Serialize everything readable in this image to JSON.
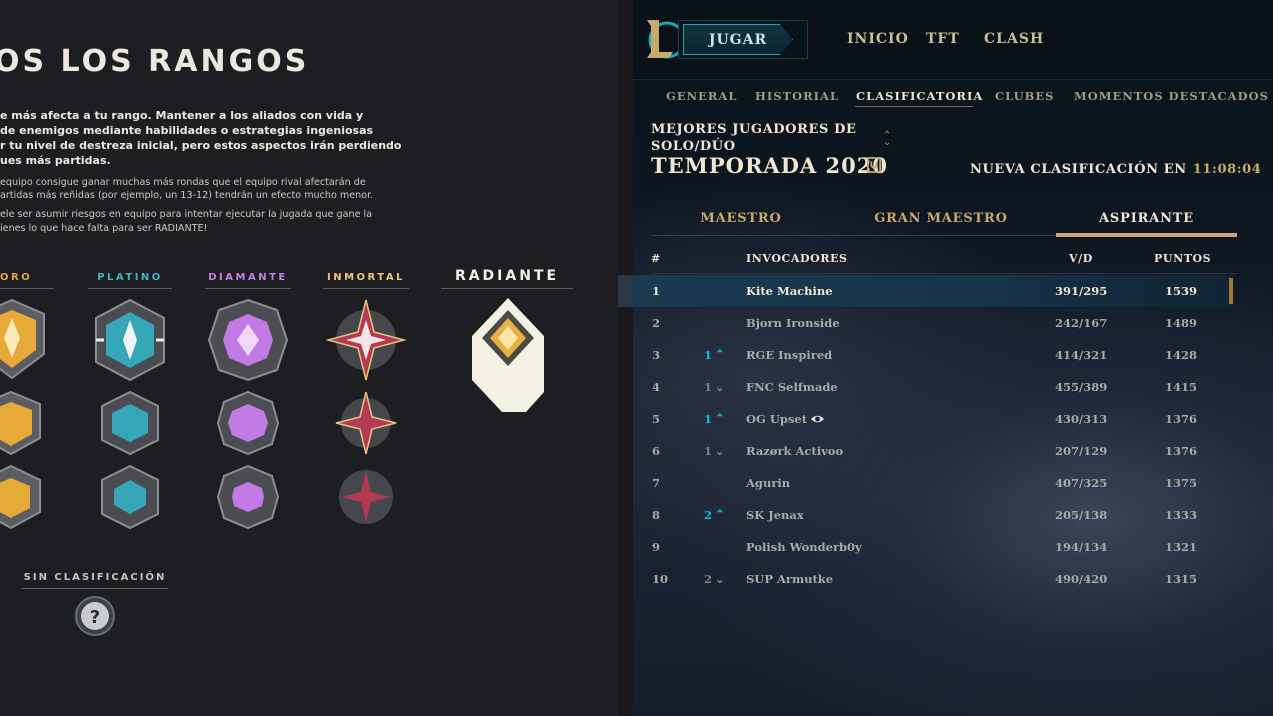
{
  "left": {
    "title": "OS LOS RANGOS",
    "paragraphs_bold": [
      "e más afecta a tu rango. Mantener a los aliados con vida y",
      "de enemigos mediante habilidades o estrategias ingeniosas",
      "r tu nivel de destreza inicial, pero estos aspectos irán perdiendo",
      "ues más partidas."
    ],
    "paragraphs_small": [
      "equipo consigue ganar muchas más rondas que el equipo rival afectarán de",
      "artidas más reñidas (por ejemplo, un 13-12) tendrán un efecto mucho menor.",
      "ele ser asumir riesgos en equipo para intentar ejecutar la jugada que gane la",
      "ienes lo que hace falta para ser RADIANTE!"
    ],
    "tiers": [
      {
        "label": "ORO",
        "color": "#e0a73a"
      },
      {
        "label": "PLATINO",
        "color": "#3fb6c6"
      },
      {
        "label": "DIAMANTE",
        "color": "#c77fe6"
      },
      {
        "label": "INMORTAL",
        "color": "#e9c77a"
      },
      {
        "label": "RADIANTE",
        "color": "#f3f0e6"
      }
    ],
    "unranked_label": "SIN CLASIFICACIÓN",
    "unranked_icon": "?"
  },
  "topbar": {
    "play_label": "JUGAR",
    "nav": [
      "INICIO",
      "TFT",
      "CLASH"
    ]
  },
  "subnav": [
    "GENERAL",
    "HISTORIAL",
    "CLASIFICATORIA",
    "CLUBES",
    "MOMENTOS DESTACADOS"
  ],
  "subnav_active": "CLASIFICATORIA",
  "ranked": {
    "queue_line1": "MEJORES JUGADORES DE",
    "queue_line2": "SOLO/DÚO",
    "season": "TEMPORADA 2020",
    "new_rank_label": "NUEVA CLASIFICACIÓN EN",
    "new_rank_time": "11:08:04",
    "tabs": [
      "MAESTRO",
      "GRAN MAESTRO",
      "ASPIRANTE"
    ],
    "active_tab": "ASPIRANTE",
    "columns": [
      "#",
      "INVOCADORES",
      "V/D",
      "PUNTOS"
    ],
    "rows": [
      {
        "rank": "1",
        "change": "",
        "dir": "",
        "name": "Kite Machine",
        "wl": "391/295",
        "pts": "1539"
      },
      {
        "rank": "2",
        "change": "",
        "dir": "",
        "name": "Bjorn Ironside",
        "wl": "242/167",
        "pts": "1489"
      },
      {
        "rank": "3",
        "change": "1",
        "dir": "up",
        "name": "RGE Inspired",
        "wl": "414/321",
        "pts": "1428"
      },
      {
        "rank": "4",
        "change": "1",
        "dir": "down",
        "name": "FNC Selfmade",
        "wl": "455/389",
        "pts": "1415"
      },
      {
        "rank": "5",
        "change": "1",
        "dir": "up",
        "name": "OG Upset",
        "wl": "430/313",
        "pts": "1376"
      },
      {
        "rank": "6",
        "change": "1",
        "dir": "down",
        "name": "Razørk Activoo",
        "wl": "207/129",
        "pts": "1376"
      },
      {
        "rank": "7",
        "change": "",
        "dir": "",
        "name": "Agurin",
        "wl": "407/325",
        "pts": "1375"
      },
      {
        "rank": "8",
        "change": "2",
        "dir": "up",
        "name": "SK Jenax",
        "wl": "205/138",
        "pts": "1333"
      },
      {
        "rank": "9",
        "change": "",
        "dir": "",
        "name": "Polish Wonderb0y",
        "wl": "194/134",
        "pts": "1321"
      },
      {
        "rank": "10",
        "change": "2",
        "dir": "down",
        "name": "SUP Armutke",
        "wl": "490/420",
        "pts": "1315"
      }
    ]
  }
}
